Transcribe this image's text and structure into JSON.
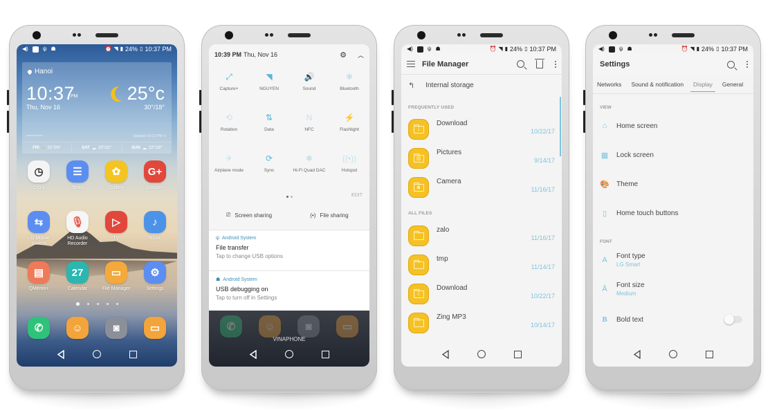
{
  "status_bar": {
    "battery": "24%",
    "time": "10:37 PM"
  },
  "home": {
    "weather": {
      "city": "Hanoi",
      "time": "10:37",
      "ampm": "PM",
      "date": "Thu, Nov 16",
      "temp": "25°c",
      "hilo": "30°/18°",
      "brand": "weathernews",
      "updated": "Updated 10:12 PM",
      "forecast": [
        {
          "day": "FRI",
          "temp": "31°/24°",
          "icon": "partly-sunny-icon"
        },
        {
          "day": "SAT",
          "temp": "29°/21°",
          "icon": "cloud-rain-icon"
        },
        {
          "day": "SUN",
          "temp": "22°/18°",
          "icon": "cloud-rain-icon"
        }
      ]
    },
    "apps": [
      {
        "label": "Clock",
        "color": "#f4f4f4",
        "glyph": "◷",
        "fg": "#333"
      },
      {
        "label": "Tasks",
        "color": "#5b8ef0",
        "glyph": "☰",
        "fg": "#fff"
      },
      {
        "label": "Gallery",
        "color": "#f3c422",
        "glyph": "✿",
        "fg": "#fff"
      },
      {
        "label": "Google+",
        "color": "#e2473b",
        "glyph": "G+",
        "fg": "#fff"
      },
      {
        "label": "LG Mobile Switch",
        "color": "#5b8ef0",
        "glyph": "⇆",
        "fg": "#fff"
      },
      {
        "label": "HD Audio Recorder",
        "color": "#f6f6f6",
        "glyph": "🎙",
        "fg": "#e45a4a"
      },
      {
        "label": "TV",
        "color": "#e2473b",
        "glyph": "▷",
        "fg": "#fff"
      },
      {
        "label": "Music",
        "color": "#4c93e8",
        "glyph": "♪",
        "fg": "#fff"
      },
      {
        "label": "QMemo+",
        "color": "#ee7a5a",
        "glyph": "▤",
        "fg": "#fff"
      },
      {
        "label": "Calendar",
        "color": "#2bb6b0",
        "glyph": "27",
        "fg": "#fff"
      },
      {
        "label": "File Manager",
        "color": "#f3a93c",
        "glyph": "▭",
        "fg": "#fff"
      },
      {
        "label": "Settings",
        "color": "#5b8ef0",
        "glyph": "⚙",
        "fg": "#fff"
      }
    ],
    "dock": [
      {
        "name": "phone",
        "color": "#2fc27a",
        "glyph": "✆"
      },
      {
        "name": "contacts",
        "color": "#f3a43a",
        "glyph": "☺"
      },
      {
        "name": "camera",
        "color": "#8a8f9a",
        "glyph": "◙"
      },
      {
        "name": "messaging",
        "color": "#f3a43a",
        "glyph": "▭"
      }
    ],
    "pages": 5,
    "active_page": 0
  },
  "shade": {
    "time": "10:39 PM",
    "date": "Thu, Nov 16",
    "tiles": [
      {
        "label": "Capture+",
        "glyph": "⤢",
        "on": true
      },
      {
        "label": "NGUYEN",
        "glyph": "◥",
        "on": true
      },
      {
        "label": "Sound",
        "glyph": "🔊",
        "on": true
      },
      {
        "label": "Bluetooth",
        "glyph": "✱",
        "on": false
      },
      {
        "label": "Rotation",
        "glyph": "⟲",
        "on": false
      },
      {
        "label": "Data",
        "glyph": "⇅",
        "on": true
      },
      {
        "label": "NFC",
        "glyph": "N",
        "on": false
      },
      {
        "label": "Flashlight",
        "glyph": "⚡",
        "on": false
      },
      {
        "label": "Airplane mode",
        "glyph": "✈",
        "on": false
      },
      {
        "label": "Sync",
        "glyph": "⟳",
        "on": true
      },
      {
        "label": "Hi-Fi Quad DAC",
        "glyph": "✱",
        "on": false
      },
      {
        "label": "Hotspot",
        "glyph": "((•))",
        "on": false
      }
    ],
    "edit": "EDIT",
    "screen_sharing": "Screen sharing",
    "file_sharing": "File sharing",
    "notifications": [
      {
        "app": "Android System",
        "title": "File transfer",
        "body": "Tap to change USB options",
        "icon": "usb-icon"
      },
      {
        "app": "Android System",
        "title": "USB debugging on",
        "body": "Tap to turn off in Settings",
        "icon": "android-icon"
      }
    ],
    "carrier": "VINAPHONE"
  },
  "file_manager": {
    "title": "File Manager",
    "path": "Internal storage",
    "frequent_header": "FREQUENTLY USED",
    "all_header": "ALL FILES",
    "frequent": [
      {
        "name": "Download",
        "date": "10/22/17",
        "glyph": "⤓"
      },
      {
        "name": "Pictures",
        "date": "9/14/17",
        "glyph": "▨"
      },
      {
        "name": "Camera",
        "date": "11/16/17",
        "glyph": "◙"
      }
    ],
    "all": [
      {
        "name": "zalo",
        "date": "11/16/17",
        "glyph": ""
      },
      {
        "name": "tmp",
        "date": "11/14/17",
        "glyph": ""
      },
      {
        "name": "Download",
        "date": "10/22/17",
        "glyph": "⤓"
      },
      {
        "name": "Zing MP3",
        "date": "10/14/17",
        "glyph": ""
      }
    ]
  },
  "settings": {
    "title": "Settings",
    "tabs": [
      "Networks",
      "Sound & notification",
      "Display",
      "General"
    ],
    "active_tab": "Display",
    "view_header": "VIEW",
    "font_header": "FONT",
    "view_items": [
      {
        "label": "Home screen",
        "glyph": "⌂"
      },
      {
        "label": "Lock screen",
        "glyph": "▦"
      },
      {
        "label": "Theme",
        "glyph": "🎨"
      },
      {
        "label": "Home touch buttons",
        "glyph": "▯"
      }
    ],
    "font_items": [
      {
        "label": "Font type",
        "sub": "LG Smart",
        "glyph": "A"
      },
      {
        "label": "Font size",
        "sub": "Medium",
        "glyph": "Ā"
      }
    ],
    "bold_text": {
      "label": "Bold text",
      "glyph": "B",
      "enabled": false
    }
  }
}
